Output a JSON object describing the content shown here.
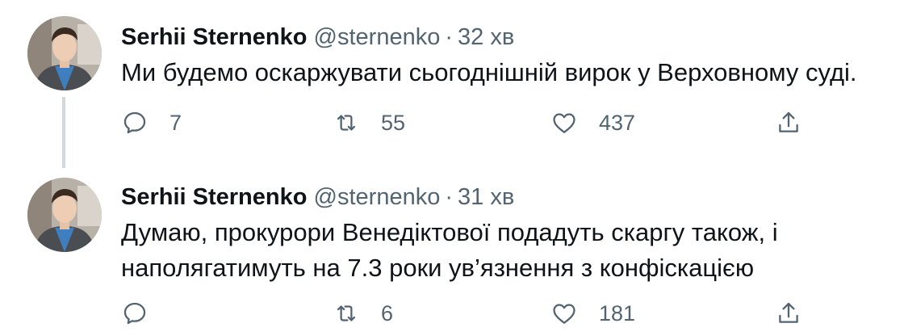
{
  "tweets": [
    {
      "author_name": "Serhii Sternenko",
      "author_handle": "@sternenko",
      "separator": "·",
      "time": "32 хв",
      "text_lines": [
        "Ми будемо оскаржувати сьогоднішній вирок у Верховному суді."
      ],
      "counts": {
        "reply": "7",
        "retweet": "55",
        "like": "437"
      }
    },
    {
      "author_name": "Serhii Sternenko",
      "author_handle": "@sternenko",
      "separator": "·",
      "time": "31 хв",
      "text_lines": [
        "Думаю, прокурори Венедіктової подадуть скаргу також, і",
        "наполягатимуть на 7.3 роки ув’язнення з конфіскацією"
      ],
      "counts": {
        "reply": "",
        "retweet": "6",
        "like": "181"
      }
    }
  ],
  "icons": {
    "reply": "reply-icon",
    "retweet": "retweet-icon",
    "like": "heart-icon",
    "share": "share-icon"
  },
  "colors": {
    "text": "#0f1419",
    "secondary": "#536471",
    "thread_line": "#cfd9de"
  }
}
